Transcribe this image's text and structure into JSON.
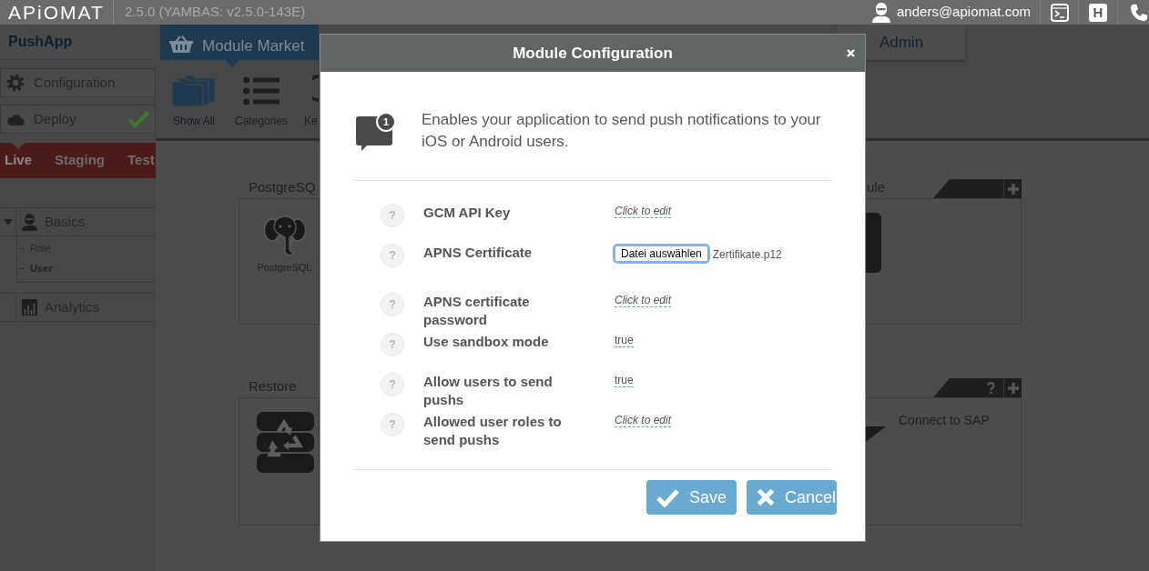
{
  "top_bar": {
    "logo": "APiOMAT",
    "version": "2.5.0 (YAMBAS: v2.5.0-143E)",
    "user_email": "anders@apiomat.com",
    "tools": [
      {
        "kind": "terminal"
      },
      {
        "kind": "letter",
        "label": "H"
      },
      {
        "kind": "phone"
      }
    ]
  },
  "sidebar": {
    "app_name": "PushApp",
    "actions": [
      {
        "kind": "configuration",
        "label": "Configuration",
        "done": false
      },
      {
        "kind": "deploy",
        "label": "Deploy",
        "done": true
      }
    ],
    "environments": [
      {
        "label": "Live",
        "selected": true
      },
      {
        "label": "Staging",
        "selected": false
      },
      {
        "label": "Test",
        "selected": false
      }
    ],
    "tree": [
      {
        "kind": "users",
        "label": "Basics",
        "expanded": true,
        "children": [
          {
            "label": "Role",
            "selected": false
          },
          {
            "label": "User",
            "selected": true
          }
        ]
      },
      {
        "kind": "analytics",
        "label": "Analytics"
      }
    ]
  },
  "module_tabs": [
    {
      "kind": "market",
      "label": "Module Market",
      "selected": true
    },
    {
      "kind": "plain",
      "label": "Admin",
      "selected": false
    }
  ],
  "toolbar": [
    {
      "kind": "folders",
      "label": "Show All",
      "selected": true
    },
    {
      "kind": "list",
      "label": "Categories",
      "selected": false
    },
    {
      "kind": "search",
      "label": "Ke",
      "selected": false
    }
  ],
  "modules": [
    {
      "kind": "postgres",
      "title": "PostgreSQ",
      "logo_caption": "PostgreSQL"
    },
    {
      "kind": "tile",
      "title": "ule",
      "actions": [
        {
          "kind": "add"
        }
      ]
    },
    {
      "kind": "restore",
      "title": "Restore"
    },
    {
      "kind": "ribbon",
      "description": "Connect to SAP",
      "actions": [
        {
          "kind": "help"
        },
        {
          "kind": "add"
        }
      ]
    }
  ],
  "modal": {
    "title": "Module Configuration",
    "badge": "1",
    "description": "Enables your application to send push notifications to your iOS or Android users.",
    "fields": [
      {
        "kind": "text",
        "help": "?",
        "label": "GCM API Key",
        "value": "Click to edit",
        "empty": true
      },
      {
        "kind": "file",
        "help": "?",
        "label": "APNS Certificate",
        "button": "Datei auswählen",
        "file_name": "Zertifikate.p12",
        "focused": true
      },
      {
        "kind": "text",
        "help": "?",
        "label": "APNS certificate password",
        "value": "Click to edit",
        "empty": true
      },
      {
        "kind": "text",
        "help": "?",
        "label": "Use sandbox mode",
        "value": "true",
        "empty": false
      },
      {
        "kind": "text",
        "help": "?",
        "label": "Allow users to send pushs",
        "value": "true",
        "empty": false
      },
      {
        "kind": "text",
        "help": "?",
        "label": "Allowed user roles to send pushs",
        "value": "Click to edit",
        "empty": true
      }
    ],
    "buttons": [
      {
        "kind": "save",
        "label": "Save"
      },
      {
        "kind": "cancel",
        "label": "Cancel"
      }
    ]
  }
}
